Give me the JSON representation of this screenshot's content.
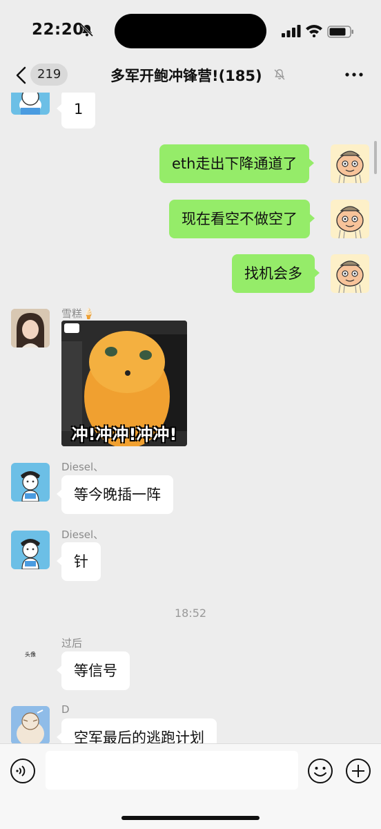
{
  "status_bar": {
    "time": "22:20",
    "icons": [
      "bell-off-icon",
      "signal-icon",
      "wifi-icon",
      "battery-icon"
    ]
  },
  "header": {
    "back_count": "219",
    "title": "多军开鲍冲锋营!(185)",
    "icons": [
      "back-chevron-icon",
      "mute-icon",
      "more-icon"
    ]
  },
  "messages": [
    {
      "type": "incoming",
      "sender": "",
      "text": "1"
    },
    {
      "type": "outgoing",
      "text": "eth走出下降通道了"
    },
    {
      "type": "outgoing",
      "text": "现在看空不做空了"
    },
    {
      "type": "outgoing",
      "text": "找机会多"
    },
    {
      "type": "incoming-sticker",
      "sender": "雪糕🍦",
      "caption": "冲!冲冲!冲冲!"
    },
    {
      "type": "incoming",
      "sender": "Diesel、",
      "text": "等今晚插一阵"
    },
    {
      "type": "incoming",
      "sender": "Diesel、",
      "text": "针"
    },
    {
      "type": "timestamp",
      "text": "18:52"
    },
    {
      "type": "incoming",
      "sender": "过后",
      "avatar_text": "头像",
      "text": "等信号"
    },
    {
      "type": "incoming",
      "sender": "D",
      "text": "空军最后的逃跑计划"
    }
  ],
  "input_bar": {
    "placeholder": "",
    "icons": [
      "voice-icon",
      "emoji-icon",
      "plus-icon"
    ]
  },
  "colors": {
    "background": "#ededed",
    "outgoing_bubble": "#95ec69",
    "incoming_bubble": "#ffffff"
  }
}
